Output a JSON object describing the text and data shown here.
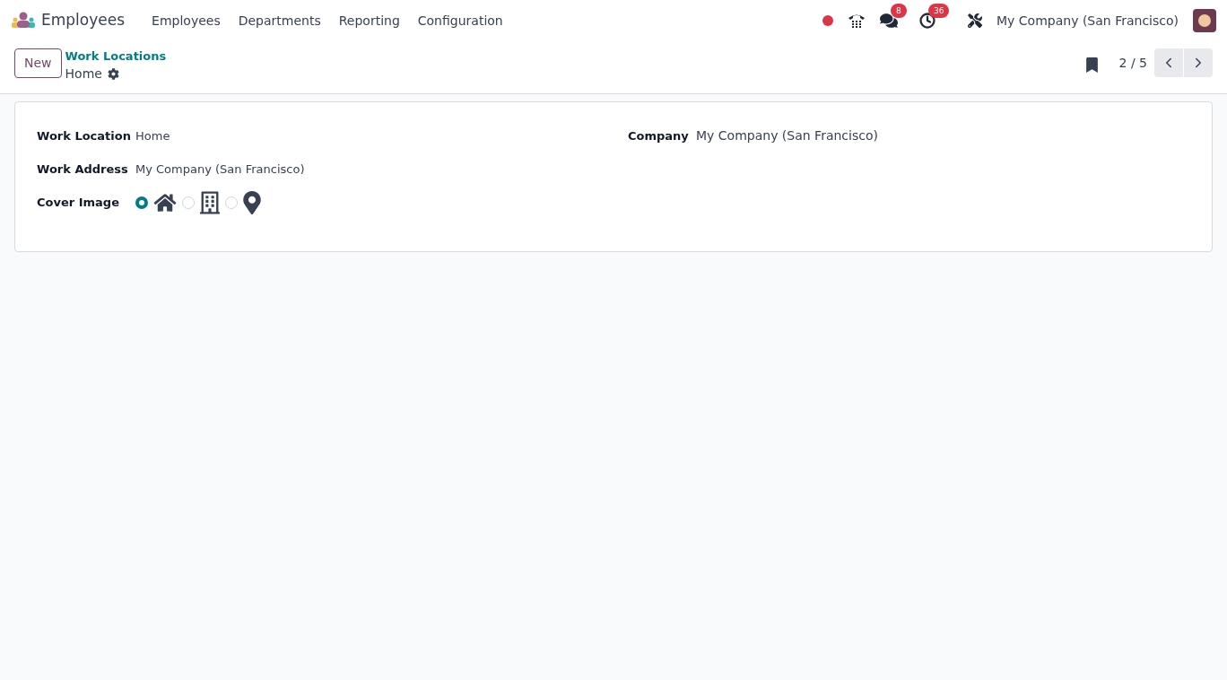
{
  "navbar": {
    "app_name": "Employees",
    "menu": [
      "Employees",
      "Departments",
      "Reporting",
      "Configuration"
    ],
    "messages_count": "8",
    "activities_count": "36",
    "company": "My Company (San Francisco)"
  },
  "control_panel": {
    "new_button": "New",
    "breadcrumb": "Work Locations",
    "record_title": "Home",
    "pager": "2 / 5"
  },
  "form": {
    "left": [
      {
        "label": "Work Location",
        "value": "Home"
      },
      {
        "label": "Work Address",
        "value": "My Company (San Francisco)"
      }
    ],
    "cover_image": {
      "label": "Cover Image",
      "options": [
        {
          "kind": "home",
          "selected": true
        },
        {
          "kind": "office",
          "selected": false
        },
        {
          "kind": "other",
          "selected": false
        }
      ]
    },
    "right": [
      {
        "label": "Company",
        "value": "My Company (San Francisco)"
      }
    ]
  }
}
